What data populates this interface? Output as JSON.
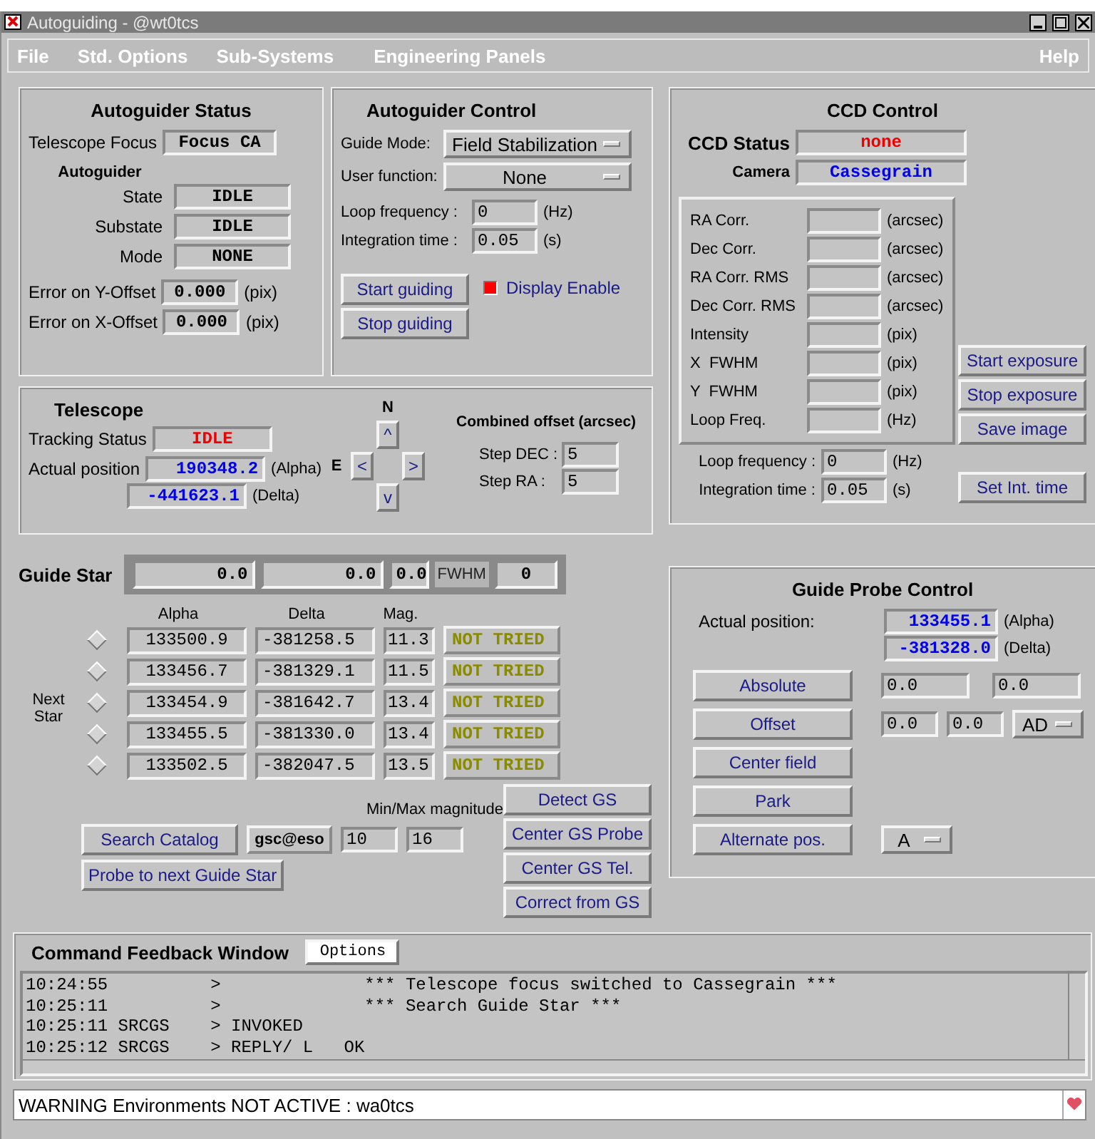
{
  "window": {
    "title": "Autoguiding - @wt0tcs"
  },
  "menu": {
    "items": [
      "File",
      "Std. Options",
      "Sub-Systems",
      "Engineering Panels"
    ],
    "help": "Help"
  },
  "autoguider_status": {
    "title": "Autoguider Status",
    "focus": {
      "label": "Telescope Focus",
      "value": "Focus CA"
    },
    "subheading": "Autoguider",
    "rows": [
      {
        "label": "State",
        "value": "IDLE"
      },
      {
        "label": "Substate",
        "value": "IDLE"
      },
      {
        "label": "Mode",
        "value": "NONE"
      }
    ],
    "errors": [
      {
        "label": "Error on Y-Offset",
        "value": "0.000",
        "unit": "(pix)"
      },
      {
        "label": "Error on X-Offset",
        "value": "0.000",
        "unit": "(pix)"
      }
    ]
  },
  "autoguider_control": {
    "title": "Autoguider Control",
    "selects": [
      {
        "label": "Guide Mode:",
        "value": "Field Stabilization"
      },
      {
        "label": "User function:",
        "value": "None"
      }
    ],
    "inputs": [
      {
        "label": "Loop frequency :",
        "value": "0",
        "unit": "(Hz)"
      },
      {
        "label": "Integration time :",
        "value": "0.05",
        "unit": "(s)"
      }
    ],
    "buttons": [
      "Start guiding",
      "Stop guiding"
    ],
    "display_enable": {
      "label": "Display Enable",
      "checked": true
    }
  },
  "ccd_control": {
    "title": "CCD Control",
    "status": {
      "label": "CCD Status",
      "value": "none"
    },
    "camera": {
      "label": "Camera",
      "value": "Cassegrain"
    },
    "readouts": [
      {
        "label": "RA Corr.",
        "unit": "(arcsec)"
      },
      {
        "label": "Dec Corr.",
        "unit": "(arcsec)"
      },
      {
        "label": "RA Corr. RMS",
        "unit": "(arcsec)"
      },
      {
        "label": "Dec Corr. RMS",
        "unit": "(arcsec)"
      },
      {
        "label": "Intensity",
        "unit": "(pix)"
      },
      {
        "label": "X  FWHM",
        "unit": "(pix)"
      },
      {
        "label": "Y  FWHM",
        "unit": "(pix)"
      },
      {
        "label": "Loop Freq.",
        "unit": "(Hz)"
      }
    ],
    "inputs": [
      {
        "label": "Loop frequency :",
        "value": "0",
        "unit": "(Hz)"
      },
      {
        "label": "Integration time :",
        "value": "0.05",
        "unit": "(s)"
      }
    ],
    "buttons": [
      "Start exposure",
      "Stop exposure",
      "Save image"
    ],
    "set_button": "Set Int. time"
  },
  "telescope": {
    "title": "Telescope",
    "tracking": {
      "label": "Tracking Status",
      "value": "IDLE"
    },
    "position": {
      "label": "Actual position",
      "alpha": {
        "value": "190348.2",
        "unit": "(Alpha)"
      },
      "delta": {
        "value": "-441623.1",
        "unit": "(Delta)"
      }
    },
    "paddle": {
      "north": "N",
      "east": "E",
      "up": "^",
      "left": "<",
      "right": ">",
      "down": "v"
    },
    "offset": {
      "title": "Combined offset (arcsec)",
      "steps": [
        {
          "label": "Step DEC :",
          "value": "5"
        },
        {
          "label": "Step RA :",
          "value": "5"
        }
      ]
    }
  },
  "guide_star": {
    "title": "Guide Star",
    "values": [
      "0.0",
      "0.0",
      "0.0"
    ],
    "fwhm": {
      "label": "FWHM",
      "value": "0"
    },
    "columns": [
      "Alpha",
      "Delta",
      "Mag."
    ],
    "side_label": "Next Star",
    "rows": [
      {
        "selected": false,
        "alpha": "133500.9",
        "delta": "-381258.5",
        "mag": "11.3",
        "status": "NOT TRIED"
      },
      {
        "selected": false,
        "alpha": "133456.7",
        "delta": "-381329.1",
        "mag": "11.5",
        "status": "NOT TRIED"
      },
      {
        "selected": false,
        "alpha": "133454.9",
        "delta": "-381642.7",
        "mag": "13.4",
        "status": "NOT TRIED"
      },
      {
        "selected": false,
        "alpha": "133455.5",
        "delta": "-381330.0",
        "mag": "13.4",
        "status": "NOT TRIED"
      },
      {
        "selected": false,
        "alpha": "133502.5",
        "delta": "-382047.5",
        "mag": "13.5",
        "status": "NOT TRIED"
      }
    ],
    "magnitude": {
      "label": "Min/Max magnitude",
      "catalog": "gsc@eso",
      "min": "10",
      "max": "16"
    },
    "left_buttons": [
      "Search Catalog",
      "Probe to next Guide Star"
    ],
    "right_buttons": [
      "Detect GS",
      "Center GS Probe",
      "Center GS Tel.",
      "Correct from GS"
    ]
  },
  "guide_probe": {
    "title": "Guide Probe Control",
    "position": {
      "label": "Actual position:",
      "alpha": {
        "value": "133455.1",
        "unit": "(Alpha)"
      },
      "delta": {
        "value": "-381328.0",
        "unit": "(Delta)"
      }
    },
    "actions": [
      {
        "label": "Absolute",
        "kind": "fields",
        "fields": [
          "0.0",
          "0.0"
        ]
      },
      {
        "label": "Offset",
        "kind": "fields-select",
        "fields": [
          "0.0",
          "0.0"
        ],
        "select": "AD"
      },
      {
        "label": "Center field",
        "kind": "plain"
      },
      {
        "label": "Park",
        "kind": "plain"
      },
      {
        "label": "Alternate pos.",
        "kind": "select",
        "select": "A"
      }
    ]
  },
  "feedback": {
    "title": "Command Feedback Window",
    "options": "Options",
    "lines": [
      "10:24:55          >              *** Telescope focus switched to Cassegrain ***",
      "10:25:11          >              *** Search Guide Star ***",
      "10:25:11 SRCGS    > INVOKED",
      "10:25:12 SRCGS    > REPLY/ L   OK"
    ]
  },
  "status_line": "WARNING Environments NOT ACTIVE : wa0tcs"
}
